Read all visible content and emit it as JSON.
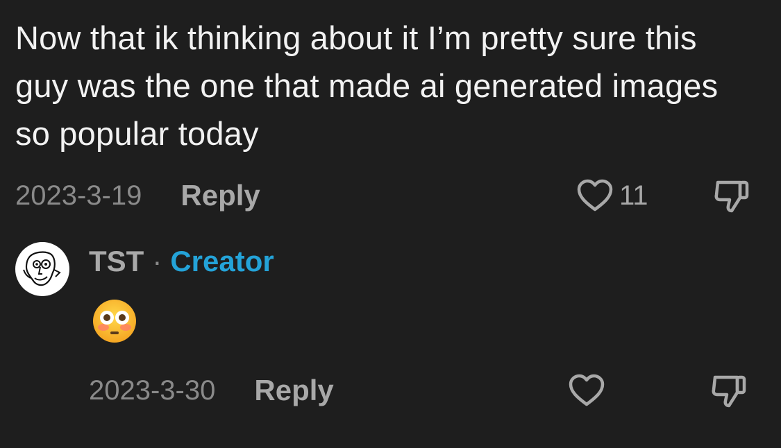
{
  "comment": {
    "text": "Now that ik thinking about it I’m pretty sure this guy was the one that made ai generated images so popular today",
    "date": "2023-3-19",
    "reply_label": "Reply",
    "like_count": "11",
    "like_icon": "heart-outline-icon",
    "dislike_icon": "thumbs-down-icon"
  },
  "reply": {
    "username": "TST",
    "separator": "·",
    "badge": "Creator",
    "badge_color": "#24a3d8",
    "emoji_icon": "flushed-face-emoji",
    "emoji_char": "😳",
    "date": "2023-3-30",
    "reply_label": "Reply",
    "like_icon": "heart-outline-icon",
    "dislike_icon": "thumbs-down-icon"
  }
}
